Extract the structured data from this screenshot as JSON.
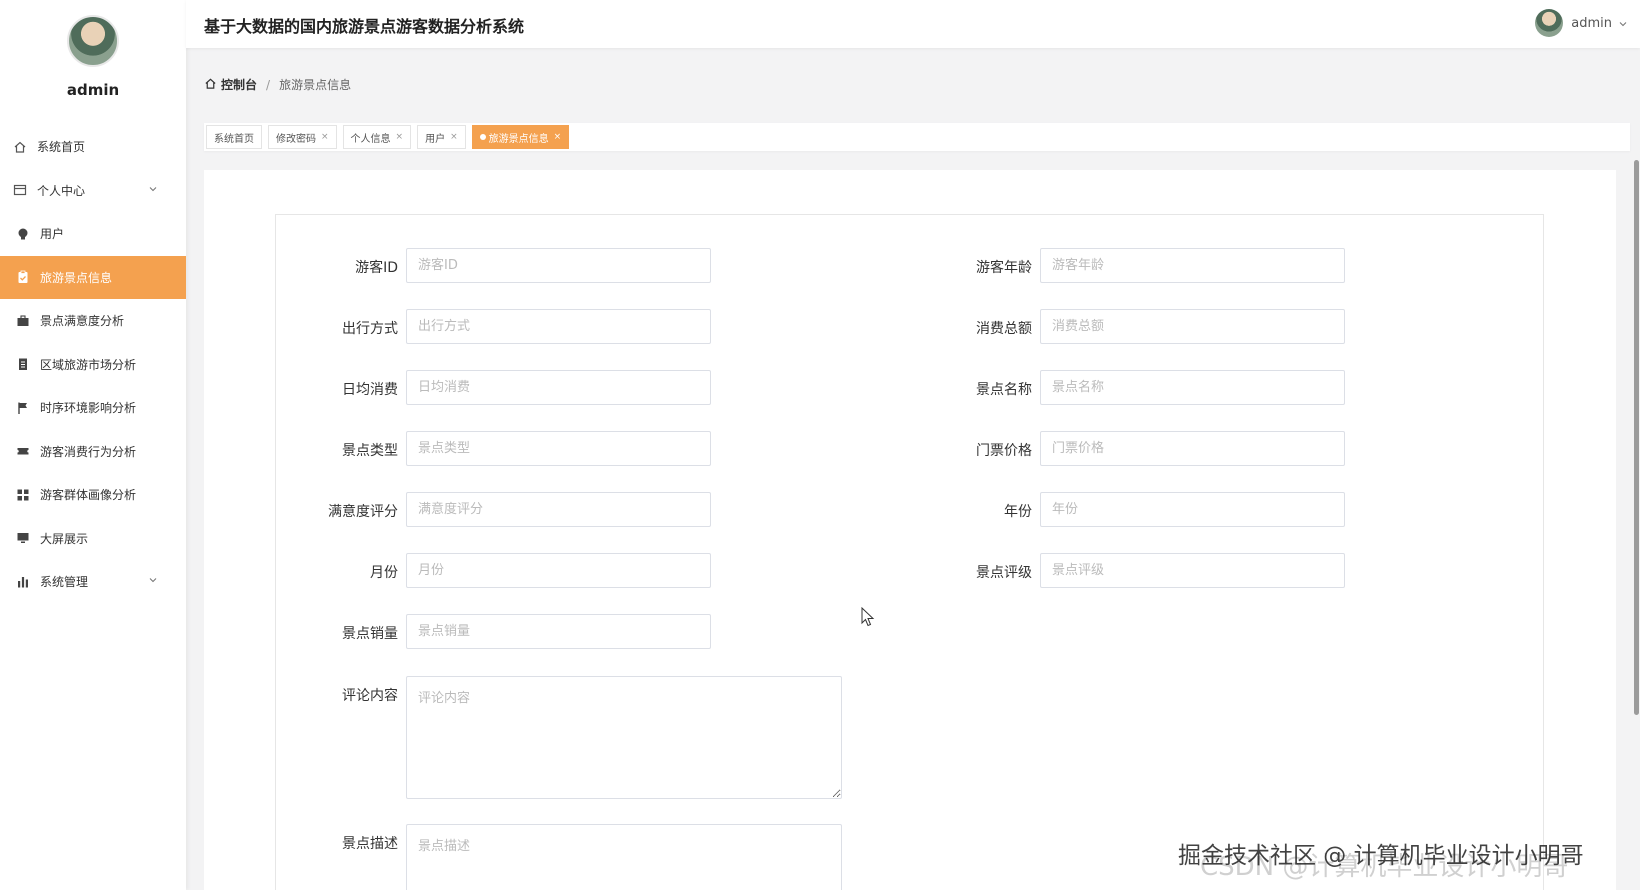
{
  "app": {
    "title": "基于大数据的国内旅游景点游客数据分析系统"
  },
  "header": {
    "username": "admin"
  },
  "sidebar": {
    "username": "admin",
    "items": [
      {
        "label": "系统首页",
        "icon": "home-icon"
      },
      {
        "label": "个人中心",
        "icon": "card-icon",
        "expandable": true
      },
      {
        "label": "用户",
        "icon": "bulb-icon"
      },
      {
        "label": "旅游景点信息",
        "icon": "clipboard-icon",
        "active": true
      },
      {
        "label": "景点满意度分析",
        "icon": "briefcase-icon"
      },
      {
        "label": "区域旅游市场分析",
        "icon": "list-icon"
      },
      {
        "label": "时序环境影响分析",
        "icon": "flag-icon"
      },
      {
        "label": "游客消费行为分析",
        "icon": "ticket-icon"
      },
      {
        "label": "游客群体画像分析",
        "icon": "grid-icon"
      },
      {
        "label": "大屏展示",
        "icon": "monitor-icon"
      },
      {
        "label": "系统管理",
        "icon": "bar-chart-icon",
        "expandable": true
      }
    ]
  },
  "breadcrumb": {
    "home": "控制台",
    "separator": "/",
    "current": "旅游景点信息"
  },
  "tabs": [
    {
      "label": "系统首页",
      "closable": false
    },
    {
      "label": "修改密码",
      "closable": true
    },
    {
      "label": "个人信息",
      "closable": true
    },
    {
      "label": "用户",
      "closable": true
    },
    {
      "label": "旅游景点信息",
      "closable": true,
      "active": true
    }
  ],
  "form": {
    "visitor_id": {
      "label": "游客ID",
      "placeholder": "游客ID",
      "value": ""
    },
    "visitor_age": {
      "label": "游客年龄",
      "placeholder": "游客年龄",
      "value": ""
    },
    "travel_mode": {
      "label": "出行方式",
      "placeholder": "出行方式",
      "value": ""
    },
    "total_spend": {
      "label": "消费总额",
      "placeholder": "消费总额",
      "value": ""
    },
    "daily_spend": {
      "label": "日均消费",
      "placeholder": "日均消费",
      "value": ""
    },
    "spot_name": {
      "label": "景点名称",
      "placeholder": "景点名称",
      "value": ""
    },
    "spot_type": {
      "label": "景点类型",
      "placeholder": "景点类型",
      "value": ""
    },
    "ticket_price": {
      "label": "门票价格",
      "placeholder": "门票价格",
      "value": ""
    },
    "satisfaction": {
      "label": "满意度评分",
      "placeholder": "满意度评分",
      "value": ""
    },
    "year": {
      "label": "年份",
      "placeholder": "年份",
      "value": ""
    },
    "month": {
      "label": "月份",
      "placeholder": "月份",
      "value": ""
    },
    "spot_level": {
      "label": "景点评级",
      "placeholder": "景点评级",
      "value": ""
    },
    "spot_sales": {
      "label": "景点销量",
      "placeholder": "景点销量",
      "value": ""
    },
    "comment": {
      "label": "评论内容",
      "placeholder": "评论内容",
      "value": ""
    },
    "description": {
      "label": "景点描述",
      "placeholder": "景点描述",
      "value": ""
    }
  },
  "watermark": {
    "line1": "掘金技术社区 @ 计算机毕业设计小明哥",
    "line2": "CSDN @计算机毕业设计小明哥"
  },
  "colors": {
    "accent": "#f4a14f",
    "sidebar_bg": "#ffffff",
    "page_bg": "#f3f3f4"
  }
}
